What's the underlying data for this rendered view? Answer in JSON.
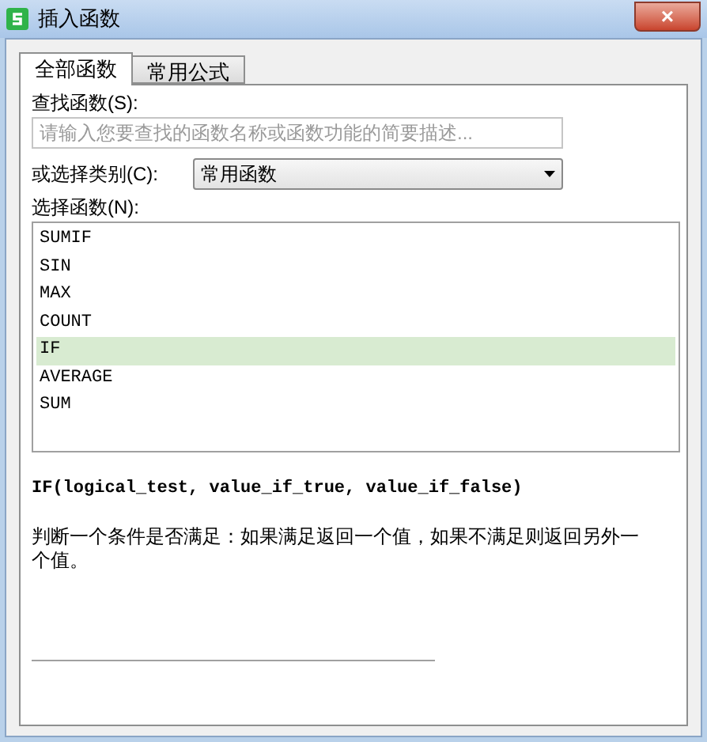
{
  "window": {
    "title": "插入函数",
    "close": "×"
  },
  "tabs": [
    {
      "label": "全部函数",
      "selected": true
    },
    {
      "label": "常用公式",
      "selected": false
    }
  ],
  "search": {
    "label": "查找函数(S):",
    "placeholder": "请输入您要查找的函数名称或函数功能的简要描述..."
  },
  "category": {
    "label": "或选择类别(C):",
    "value": "常用函数"
  },
  "functions": {
    "label": "选择函数(N):",
    "items": [
      {
        "name": "SUMIF",
        "selected": false
      },
      {
        "name": "SIN",
        "selected": false
      },
      {
        "name": "MAX",
        "selected": false
      },
      {
        "name": "COUNT",
        "selected": false
      },
      {
        "name": "IF",
        "selected": true
      },
      {
        "name": "AVERAGE",
        "selected": false
      },
      {
        "name": "SUM",
        "selected": false
      }
    ]
  },
  "syntax": "IF(logical_test, value_if_true, value_if_false)",
  "description": "判断一个条件是否满足：如果满足返回一个值，如果不满足则返回另外一个值。"
}
